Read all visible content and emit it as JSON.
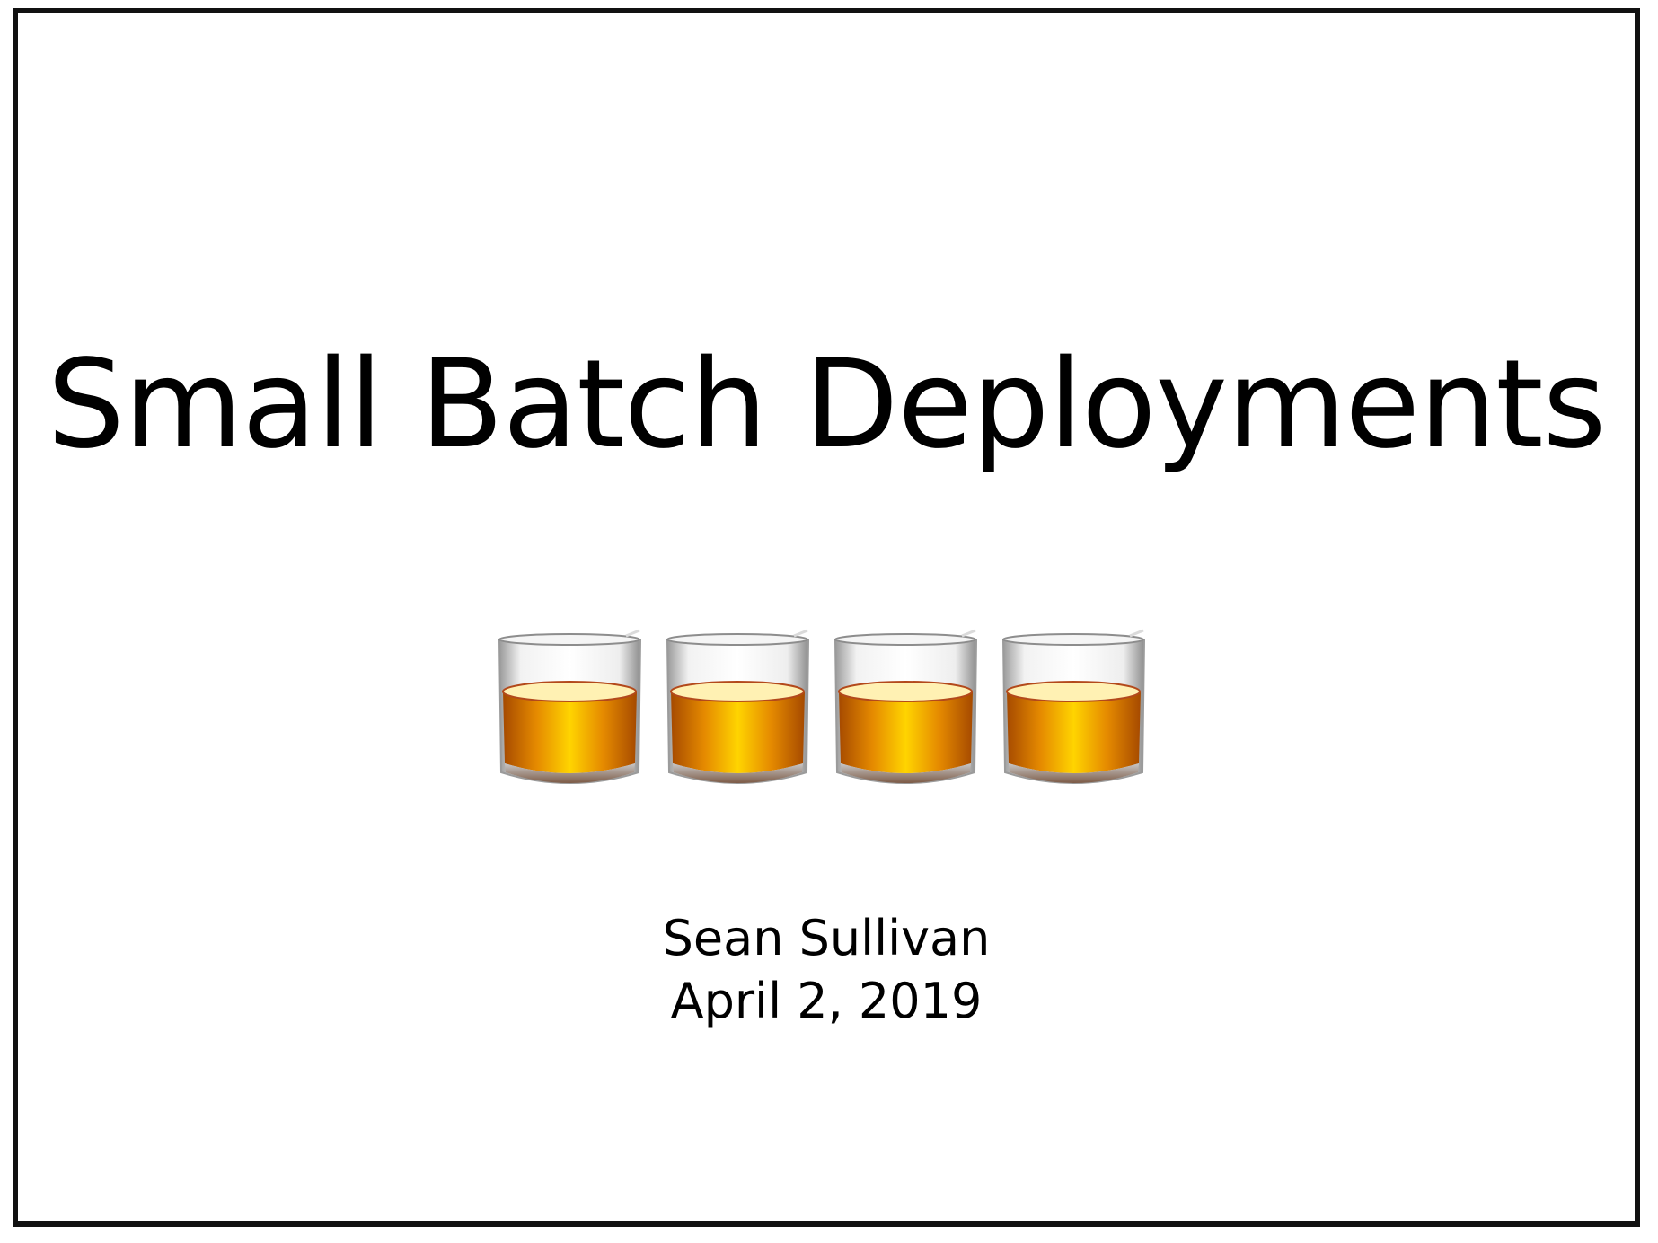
{
  "slide": {
    "title": "Small Batch Deployments",
    "author": "Sean Sullivan",
    "date": "April 2, 2019",
    "glasses": [
      {
        "icon": "tumbler-glass-icon"
      },
      {
        "icon": "tumbler-glass-icon"
      },
      {
        "icon": "tumbler-glass-icon"
      },
      {
        "icon": "tumbler-glass-icon"
      }
    ],
    "colors": {
      "border": "#111111",
      "text": "#000000",
      "whiskey_light": "#ffd400",
      "whiskey_dark": "#a64a00",
      "background": "#ffffff"
    }
  }
}
